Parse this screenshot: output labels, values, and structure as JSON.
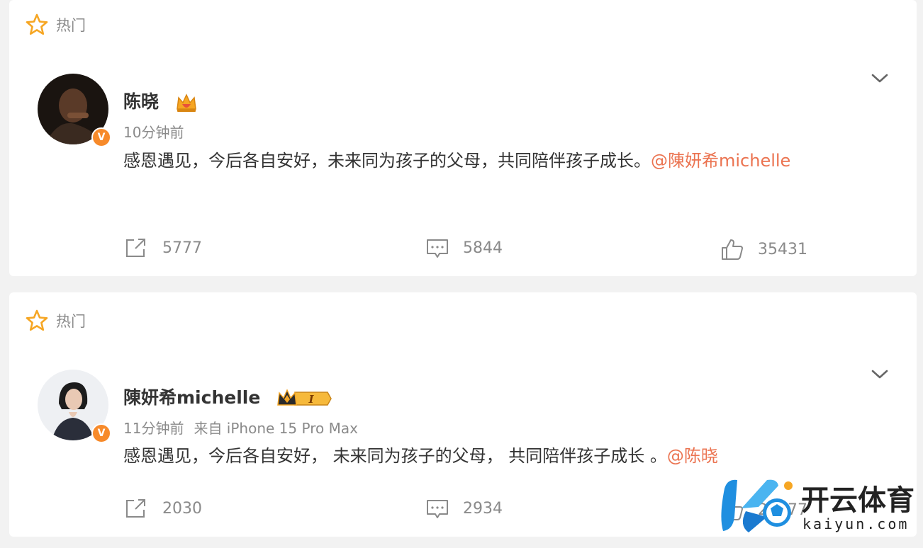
{
  "posts": [
    {
      "hot_label": "热门",
      "author": "陈晓",
      "time": "10分钟前",
      "source": "",
      "text": "感恩遇见，今后各自安好，未来同为孩子的父母，共同陪伴孩子成长。",
      "mention": "@陳妍希michelle",
      "reposts": "5777",
      "comments": "5844",
      "likes": "35431"
    },
    {
      "hot_label": "热门",
      "author": "陳妍希michelle",
      "time": "11分钟前",
      "source": "来自 iPhone 15 Pro Max",
      "text": "感恩遇见，今后各自安好， 未来同为孩子的父母， 共同陪伴孩子成长 。",
      "mention": "@陈晓",
      "reposts": "2030",
      "comments": "2934",
      "likes": "22077",
      "badge_text": "I"
    }
  ],
  "watermark": {
    "title": "开云体育",
    "subtitle": "kaiyun.com"
  },
  "icons": {
    "hot": "star-icon",
    "verified": "verified-v-icon",
    "more": "chevron-down-icon",
    "repost": "share-icon",
    "comment": "comment-icon",
    "like": "thumbs-up-icon"
  },
  "colors": {
    "accent": "#eb7350",
    "star": "#f6a623",
    "verified": "#f78a2a"
  }
}
